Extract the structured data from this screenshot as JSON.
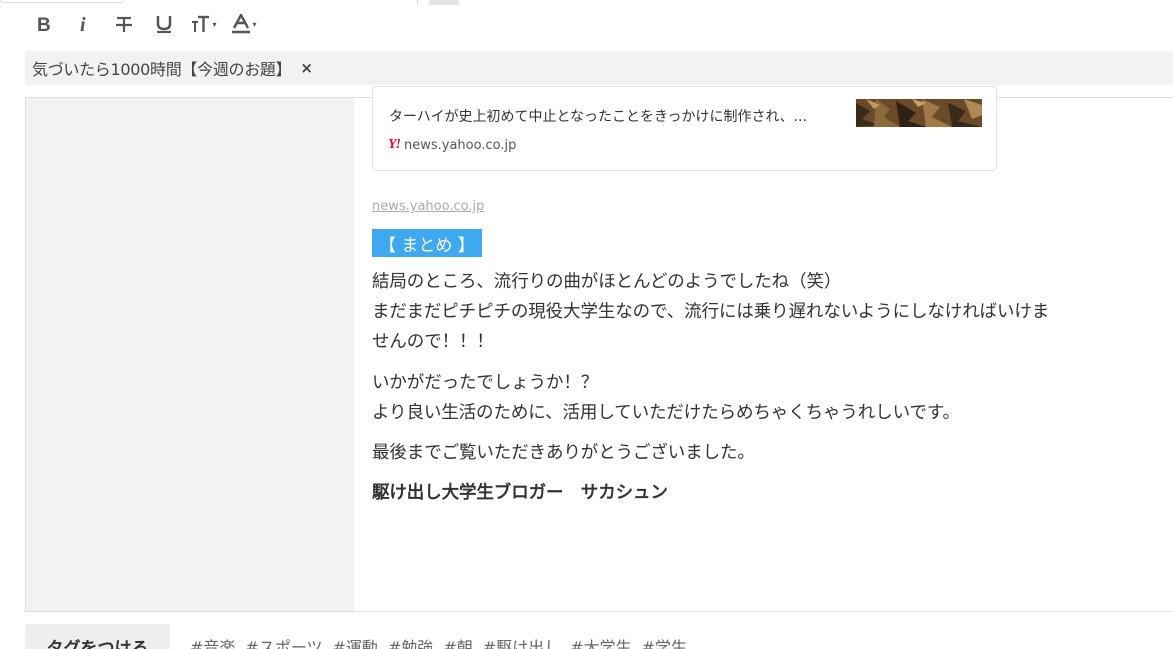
{
  "toolbar": {
    "buttons": [
      {
        "name": "bold-button",
        "icon": "bold-icon"
      },
      {
        "name": "italic-button",
        "icon": "italic-icon"
      },
      {
        "name": "strikethrough-button",
        "icon": "strikethrough-icon"
      },
      {
        "name": "underline-button",
        "icon": "underline-icon"
      },
      {
        "name": "font-size-button",
        "icon": "font-size-icon"
      },
      {
        "name": "text-color-button",
        "icon": "text-color-icon"
      }
    ]
  },
  "topic": {
    "label": "気づいたら1000時間【今週のお題】",
    "close_label": "×"
  },
  "link_card": {
    "description": "ターハイが史上初めて中止となったことをきっかけに制作され、...",
    "logo_text": "Y!",
    "domain": "news.yahoo.co.jp",
    "thumbnail_icon": "article-thumbnail-image"
  },
  "source_link": "news.yahoo.co.jp",
  "summary_badge": "【 まとめ 】",
  "paragraphs": {
    "p1_line1": "結局のところ、流行りの曲がほとんどのようでしたね（笑）",
    "p1_line2": "まだまだピチピチの現役大学生なので、流行には乗り遅れないようにしなければいけま",
    "p1_line3": "せんので！！！",
    "p2_line1": "いかがだったでしょうか！？",
    "p2_line2": "より良い生活のために、活用していただけたらめちゃくちゃうれしいです。",
    "p3_line1": "最後までご覧いただきありがとうございました。"
  },
  "signature": "駆け出し大学生ブロガー　サカシュン",
  "tags": {
    "button_label": "タグをつける",
    "items": [
      "#音楽",
      "#スポーツ",
      "#運動",
      "#勉強",
      "#朝",
      "#駆け出し",
      "#大学生",
      "#学生"
    ]
  },
  "colors": {
    "accent": "#3ea8f1",
    "yahoo_red": "#ff0033",
    "gutter": "#f2f2f2"
  }
}
